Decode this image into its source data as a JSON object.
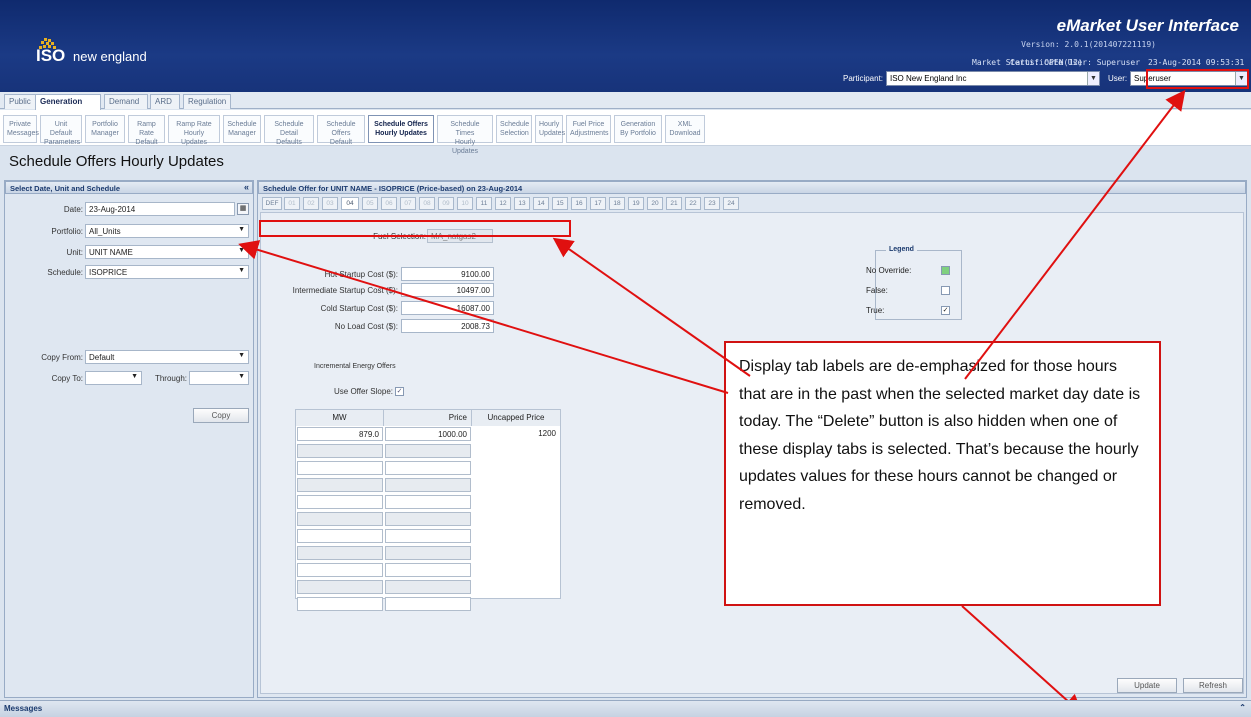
{
  "header": {
    "logo_iso": "ISO",
    "logo_name": "new england",
    "app_title": "eMarket User Interface",
    "version": "Version: 2.0.1(201407221119)",
    "market_status": "Market Status: OPEN(12)",
    "certificate_user": "Certificate User: Superuser",
    "datetime": "23-Aug-2014 09:53:31",
    "participant_label": "Participant:",
    "participant_value": "ISO New England Inc",
    "user_label": "User:",
    "user_value": "Superuser"
  },
  "top_tabs": [
    "Public",
    "Generation",
    "Demand",
    "ARD",
    "Regulation"
  ],
  "sub_tabs": [
    [
      "Private",
      "Messages"
    ],
    [
      "Unit Default",
      "Parameters"
    ],
    [
      "Portfolio",
      "Manager"
    ],
    [
      "Ramp Rate",
      "Default"
    ],
    [
      "Ramp Rate",
      "Hourly Updates"
    ],
    [
      "Schedule",
      "Manager"
    ],
    [
      "Schedule",
      "Detail Defaults"
    ],
    [
      "Schedule",
      "Offers Default"
    ],
    [
      "Schedule Offers",
      "Hourly Updates"
    ],
    [
      "Schedule Times",
      "Hourly Updates"
    ],
    [
      "Schedule",
      "Selection"
    ],
    [
      "Hourly",
      "Updates"
    ],
    [
      "Fuel Price",
      "Adjustments"
    ],
    [
      "Generation",
      "By Portfolio"
    ],
    [
      "XML",
      "Download"
    ]
  ],
  "page_title": "Schedule Offers Hourly Updates",
  "left_panel": {
    "title": "Select Date, Unit and Schedule",
    "collapse_icon": "«",
    "date_label": "Date:",
    "date_value": "23-Aug-2014",
    "portfolio_label": "Portfolio:",
    "portfolio_value": "All_Units",
    "unit_label": "Unit:",
    "unit_value": "UNIT NAME",
    "schedule_label": "Schedule:",
    "schedule_value": "ISOPRICE",
    "copy_from_label": "Copy From:",
    "copy_from_value": "Default",
    "copy_to_label": "Copy To:",
    "through_label": "Through:",
    "copy_button": "Copy"
  },
  "right_panel": {
    "title": "Schedule Offer for UNIT NAME - ISOPRICE (Price-based) on 23-Aug-2014",
    "hour_tabs": [
      "DEF",
      "01",
      "02",
      "03",
      "04",
      "05",
      "06",
      "07",
      "08",
      "09",
      "10",
      "11",
      "12",
      "13",
      "14",
      "15",
      "16",
      "17",
      "18",
      "19",
      "20",
      "21",
      "22",
      "23",
      "24"
    ],
    "fuel_label": "Fuel Selection:",
    "fuel_value": "MA_natgas2",
    "hot_label": "Hot Startup Cost ($):",
    "hot_value": "9100.00",
    "int_label": "Intermediate Startup Cost ($):",
    "int_value": "10497.00",
    "cold_label": "Cold Startup Cost ($):",
    "cold_value": "16087.00",
    "noload_label": "No Load Cost ($):",
    "noload_value": "2008.73",
    "incremental_label": "Incremental Energy Offers",
    "slope_label": "Use Offer Slope:",
    "offer_columns": [
      "MW",
      "Price",
      "Uncapped Price"
    ],
    "offer_row": [
      "879.0",
      "1000.00",
      "1200"
    ],
    "legend_title": "Legend",
    "legend_items": [
      "No Override:",
      "False:",
      "True:"
    ],
    "update_button": "Update",
    "refresh_button": "Refresh"
  },
  "callout": "Display tab labels are de-emphasized for those hours that are in the past when the selected market day date is today. The “Delete” button is also hidden when one of these display tabs is selected. That’s because the hourly updates values for these hours cannot be changed or removed.",
  "messages_label": "Messages",
  "colors": {
    "annotation_red": "#e01010",
    "header_blue": "#1b3a85"
  }
}
